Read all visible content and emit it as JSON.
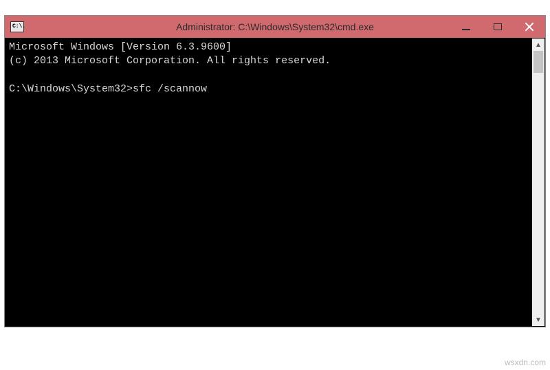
{
  "window": {
    "title": "Administrator: C:\\Windows\\System32\\cmd.exe",
    "icon_text": "C:\\."
  },
  "terminal": {
    "line1": "Microsoft Windows [Version 6.3.9600]",
    "line2": "(c) 2013 Microsoft Corporation. All rights reserved.",
    "blank": "",
    "prompt": "C:\\Windows\\System32>",
    "command": "sfc /scannow"
  },
  "watermark": "wsxdn.com"
}
